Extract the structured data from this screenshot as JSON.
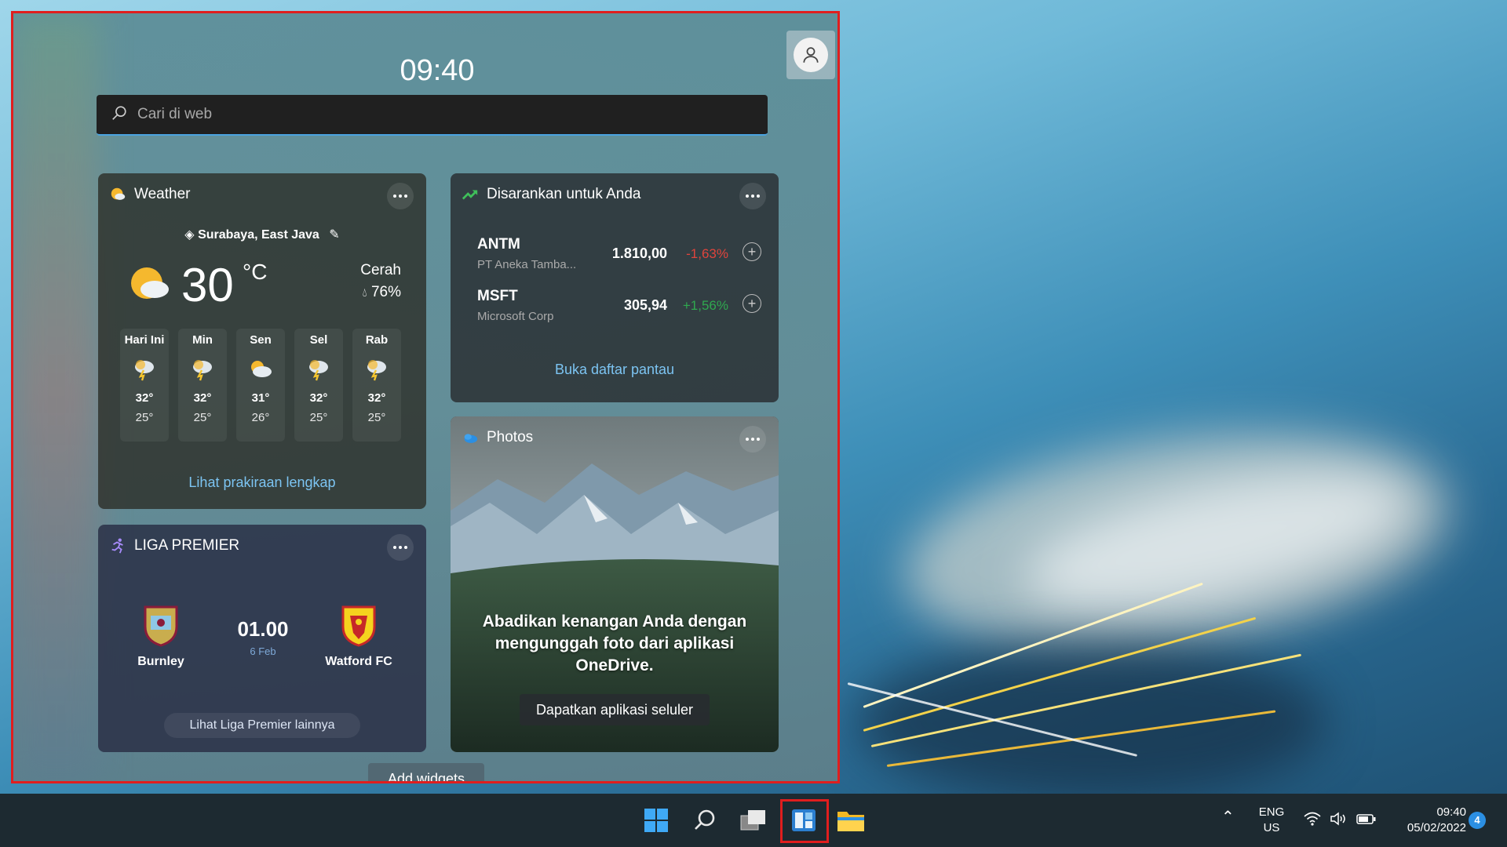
{
  "board": {
    "time": "09:40",
    "search_placeholder": "Cari di web",
    "add_widgets": "Add widgets"
  },
  "weather": {
    "title": "Weather",
    "location": "Surabaya, East Java",
    "temperature": "30",
    "unit": "°C",
    "condition": "Cerah",
    "humidity": "76%",
    "forecast": [
      {
        "day": "Hari Ini",
        "icon": "thunderstorm-icon",
        "high": "32°",
        "low": "25°"
      },
      {
        "day": "Min",
        "icon": "thunderstorm-icon",
        "high": "32°",
        "low": "25°"
      },
      {
        "day": "Sen",
        "icon": "partly-cloudy-icon",
        "high": "31°",
        "low": "26°"
      },
      {
        "day": "Sel",
        "icon": "thunderstorm-icon",
        "high": "32°",
        "low": "25°"
      },
      {
        "day": "Rab",
        "icon": "thunderstorm-icon",
        "high": "32°",
        "low": "25°"
      }
    ],
    "link": "Lihat prakiraan lengkap"
  },
  "stocks": {
    "title": "Disarankan untuk Anda",
    "items": [
      {
        "symbol": "ANTM",
        "name": "PT Aneka Tamba...",
        "price": "1.810,00",
        "change": "-1,63%",
        "direction": "down"
      },
      {
        "symbol": "MSFT",
        "name": "Microsoft Corp",
        "price": "305,94",
        "change": "+1,56%",
        "direction": "up"
      }
    ],
    "link": "Buka daftar pantau"
  },
  "photos": {
    "title": "Photos",
    "message": "Abadikan kenangan Anda dengan mengunggah foto dari aplikasi OneDrive.",
    "button": "Dapatkan aplikasi seluler"
  },
  "league": {
    "title": "LIGA PREMIER",
    "home_team": "Burnley",
    "away_team": "Watford FC",
    "time": "01.00",
    "date": "6 Feb",
    "link": "Lihat Liga Premier lainnya"
  },
  "taskbar": {
    "icons": [
      "windows-start-icon",
      "search-icon",
      "task-view-icon",
      "widgets-icon",
      "file-explorer-icon"
    ],
    "lang_top": "ENG",
    "lang_bottom": "US",
    "time": "09:40",
    "date": "05/02/2022",
    "notification_count": "4"
  },
  "colors": {
    "highlight": "#e01e1e",
    "link": "#7cc4f2",
    "down": "#e0443c",
    "up": "#2fa84f"
  }
}
